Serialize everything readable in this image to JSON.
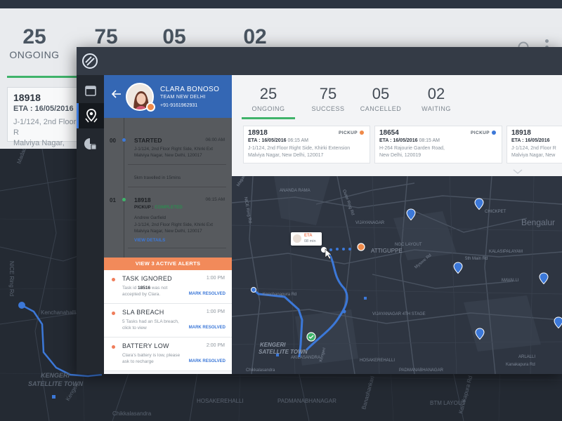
{
  "background": {
    "stats": [
      {
        "value": "25",
        "label": "ONGOING"
      },
      {
        "value": "75",
        "label": ""
      },
      {
        "value": "05",
        "label": ""
      },
      {
        "value": "02",
        "label": ""
      }
    ],
    "card": {
      "id": "18918",
      "eta": "ETA : 16/05/2016",
      "address_line1": "J-1/124, 2nd Floor R",
      "address_line2": "Malviya Nagar, New"
    },
    "map_labels": [
      "Kenchanahalli",
      "KENGERI",
      "SATELLITE TOWN",
      "Kengeri",
      "HOSAKEREHALLI",
      "PADMANABHANAGAR",
      "BTM LAYOUT",
      "Chikkalasandra",
      "Banashankari",
      "Madadi Rd",
      "NICE Ring Rd",
      "Kanakapura Rd"
    ]
  },
  "nav": {
    "items": [
      {
        "name": "calendar",
        "icon": "calendar-icon"
      },
      {
        "name": "agent-tracking",
        "icon": "map-pin-icon"
      },
      {
        "name": "reports",
        "icon": "pie-chart-icon"
      }
    ]
  },
  "agent": {
    "name": "CLARA BONOSO",
    "team": "TEAM NEW DELHI",
    "phone": "+91-9161962931"
  },
  "timeline": [
    {
      "index": "00",
      "title": "STARTED",
      "time": "06:00 AM",
      "dot_color": "#3c78d8",
      "text1": "J-1/124, 2nd Floor Right Side, Khirki Ext",
      "text2": "Malviya Nagar, New Delhi, 120017"
    },
    {
      "travel": "5km travelled in 15mins"
    },
    {
      "index": "01",
      "title": "18918",
      "time": "06:15 AM",
      "dot_color": "#3fb36a",
      "pickup_label": "PICKUP : ",
      "status": "COMPLETED",
      "person": "Andrew Garfield",
      "text1": "J-1/124, 2nd Floor Right Side, Khirki Ext",
      "text2": "Malviya Nagar, New Delhi, 120017",
      "link": "VIEW DETAILS"
    }
  ],
  "alerts": {
    "banner": "VIEW 3 ACTIVE ALERTS",
    "items": [
      {
        "title": "TASK IGNORED",
        "time": "1:00 PM",
        "desc_pre": "Task id ",
        "desc_id": "18516",
        "desc_post": " was not accepted by Clara.",
        "action": "MARK RESOLVED"
      },
      {
        "title": "SLA BREACH",
        "time": "1:00 PM",
        "desc": "5 Tasks had an SLA breach, click to view",
        "action": "MARK RESOLVED"
      },
      {
        "title": "BATTERY LOW",
        "time": "2:00 PM",
        "desc": "Clara's battery is low, please ask to recharge",
        "action": "MARK RESOLVED"
      }
    ]
  },
  "stats": [
    {
      "value": "25",
      "label": "ONGOING"
    },
    {
      "value": "75",
      "label": "SUCCESS"
    },
    {
      "value": "05",
      "label": "CANCELLED"
    },
    {
      "value": "02",
      "label": "WAITING"
    }
  ],
  "orders": [
    {
      "id": "18918",
      "type": "PICKUP",
      "type_color": "#ef8a4a",
      "eta_label": "ETA : 16/05/2016",
      "eta_time": "06:15 AM",
      "address_line1": "J-1/124, 2nd Floor Right Side, Khirki Extension",
      "address_line2": "Malviya Nagar, New Delhi, 120017"
    },
    {
      "id": "18654",
      "type": "PICKUP",
      "type_color": "#3c78d8",
      "eta_label": "ETA : 16/05/2016",
      "eta_time": "08:15 AM",
      "address_line1": "H-264 Rajourie Garden Road,",
      "address_line2": "New Delhi, 120019"
    },
    {
      "id": "18918",
      "type": "",
      "type_color": "",
      "eta_label": "ETA : 16/05/2016",
      "eta_time": "",
      "address_line1": "J-1/124, 2nd Floor R",
      "address_line2": "Malviya Nagar, New"
    }
  ],
  "map": {
    "eta_tag": {
      "title": "ETA",
      "minutes": "08 min"
    },
    "labels": [
      "ANANDA RAMA",
      "Magadi Rd",
      "NICE Ring Rd",
      "Outer Ring Rd",
      "VIJAYANAGAR",
      "ATTIGUPPE",
      "NGC LAYOUT",
      "Mysore Rd",
      "Bengalur",
      "KALASIPALAYAM",
      "5th Main Rd",
      "Kenchanapura Rd",
      "VIJAYANAGAR 4TH STAGE",
      "KENGERI",
      "SATELLITE TOWN",
      "AKILASANDRA",
      "HOSAKEREHALLI",
      "PADMANABHANAGAR",
      "Kengeri",
      "Chikkalasandra",
      "CHICKPET",
      "MAVALLI",
      "Kanakapura Rd",
      "ARLALLI"
    ]
  },
  "colors": {
    "accent": "#3c78d8",
    "success": "#3fb36a",
    "alert": "#f28a5a",
    "header": "#3467b4"
  }
}
